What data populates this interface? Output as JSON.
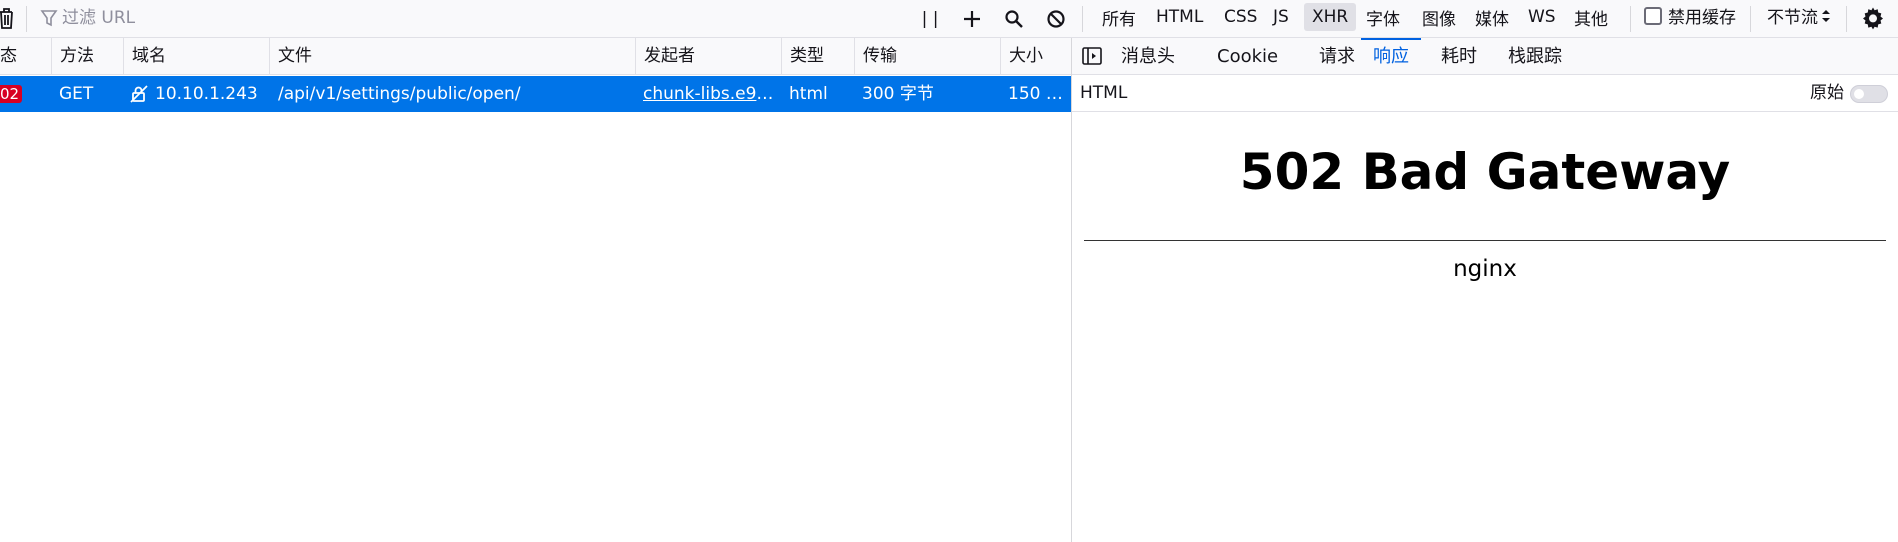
{
  "toolbar": {
    "filter_placeholder": "过滤 URL",
    "pause_label": "| |",
    "type_filters": [
      "所有",
      "HTML",
      "CSS",
      "JS",
      "XHR",
      "字体",
      "图像",
      "媒体",
      "WS",
      "其他"
    ],
    "active_filter": "XHR",
    "disable_cache_label": "禁用缓存",
    "throttle_label": "不节流"
  },
  "table": {
    "headers": [
      "态",
      "方法",
      "域名",
      "文件",
      "发起者",
      "类型",
      "传输",
      "大小"
    ],
    "rows": [
      {
        "status": "02",
        "method": "GET",
        "domain": "10.10.1.243",
        "file": "/api/v1/settings/public/open/",
        "initiator": "chunk-libs.e9b…",
        "type": "html",
        "transferred": "300 字节",
        "size": "150 …"
      }
    ]
  },
  "details": {
    "tabs": [
      "消息头",
      "Cookie",
      "请求",
      "响应",
      "耗时",
      "栈跟踪"
    ],
    "active_tab": "响应",
    "response_type": "HTML",
    "raw_label": "原始",
    "raw_enabled": false,
    "preview_title": "502 Bad Gateway",
    "preview_server": "nginx"
  },
  "colors": {
    "selected_row": "#0074e8",
    "status_error": "#d70022",
    "active_tab": "#0061e0"
  }
}
